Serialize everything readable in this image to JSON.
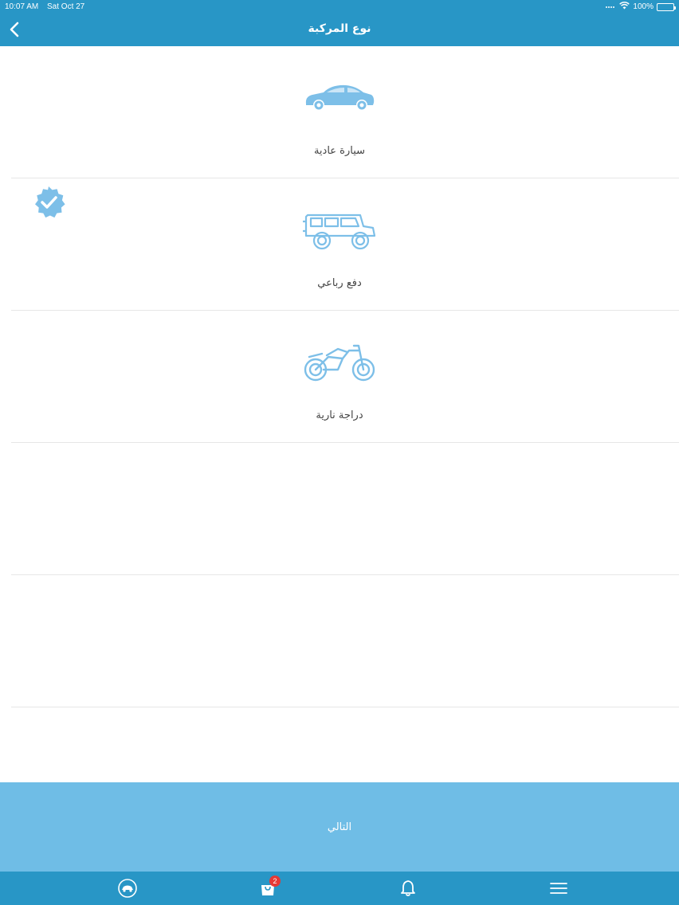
{
  "status_bar": {
    "time": "10:07 AM",
    "date": "Sat Oct 27",
    "battery": "100%"
  },
  "header": {
    "title": "نوع المركبة"
  },
  "vehicle_types": [
    {
      "label": "سيارة عادية",
      "icon": "sedan-car-icon",
      "selected": false
    },
    {
      "label": "دفع رباعي",
      "icon": "jeep-4x4-icon",
      "selected": true
    },
    {
      "label": "دراجة نارية",
      "icon": "motorcycle-icon",
      "selected": false
    }
  ],
  "next_button": {
    "label": "التالي"
  },
  "tabbar": {
    "items": [
      {
        "icon": "car-logo-icon"
      },
      {
        "icon": "shopping-bag-icon",
        "badge": "2"
      },
      {
        "icon": "bell-icon"
      },
      {
        "icon": "hamburger-menu-icon"
      }
    ]
  },
  "colors": {
    "primary": "#2896c6",
    "button": "#6fbde6",
    "icon": "#7dbfe8",
    "badge": "#e53935"
  }
}
